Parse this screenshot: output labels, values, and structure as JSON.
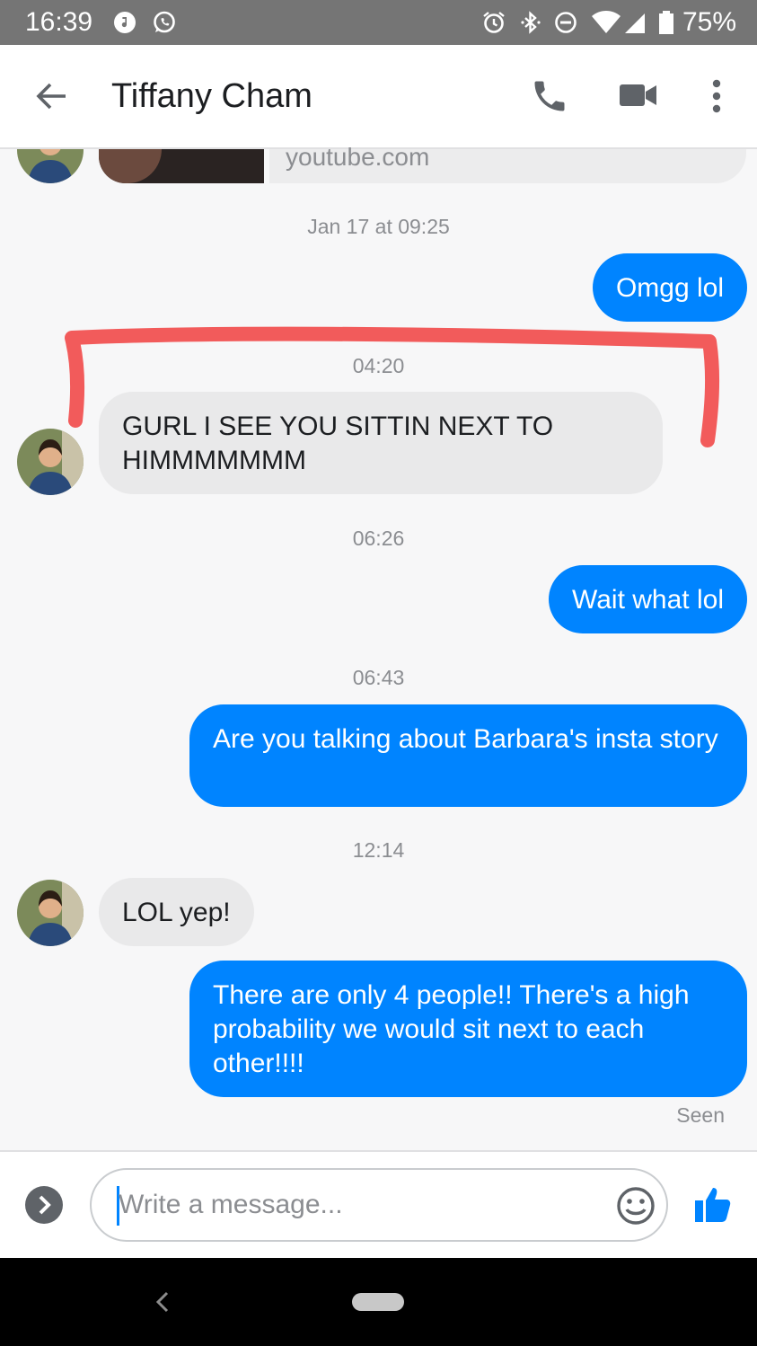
{
  "status_bar": {
    "time": "16:39",
    "battery": "75%",
    "icons": [
      "music-note-icon",
      "whatsapp-icon",
      "alarm-icon",
      "bluetooth-icon",
      "do-not-disturb-icon",
      "wifi-icon",
      "signal-icon",
      "battery-icon"
    ]
  },
  "header": {
    "back_icon": "arrow-left-icon",
    "title": "Tiffany Cham",
    "actions": [
      "phone-icon",
      "video-icon",
      "more-vertical-icon"
    ]
  },
  "chat": {
    "link_preview_domain": "youtube.com",
    "messages": [
      {
        "type": "timestamp",
        "text": "Jan 17 at 09:25"
      },
      {
        "type": "outgoing",
        "text": "Omgg lol"
      },
      {
        "type": "timestamp",
        "text": "04:20"
      },
      {
        "type": "incoming",
        "text": "GURL I SEE YOU SITTIN NEXT TO HIMMMMMMM"
      },
      {
        "type": "timestamp",
        "text": "06:26"
      },
      {
        "type": "outgoing",
        "text": "Wait what lol"
      },
      {
        "type": "timestamp",
        "text": "06:43"
      },
      {
        "type": "outgoing",
        "text": "Are you talking about Barbara's insta story"
      },
      {
        "type": "timestamp",
        "text": "12:14"
      },
      {
        "type": "incoming",
        "text": "LOL yep!"
      },
      {
        "type": "outgoing",
        "text": "There are only 4 people!! There's a high probability we would sit next to each other!!!!"
      }
    ],
    "seen": "Seen"
  },
  "composer": {
    "placeholder": "Write a message...",
    "expand_icon": "chevron-right-circle-icon",
    "emoji_icon": "emoji-icon",
    "like_icon": "thumbs-up-icon"
  },
  "colors": {
    "outgoing_bubble": "#0084ff",
    "incoming_bubble": "#e9e9ea",
    "annotation": "#f25b5b",
    "status_bar": "#757575"
  }
}
